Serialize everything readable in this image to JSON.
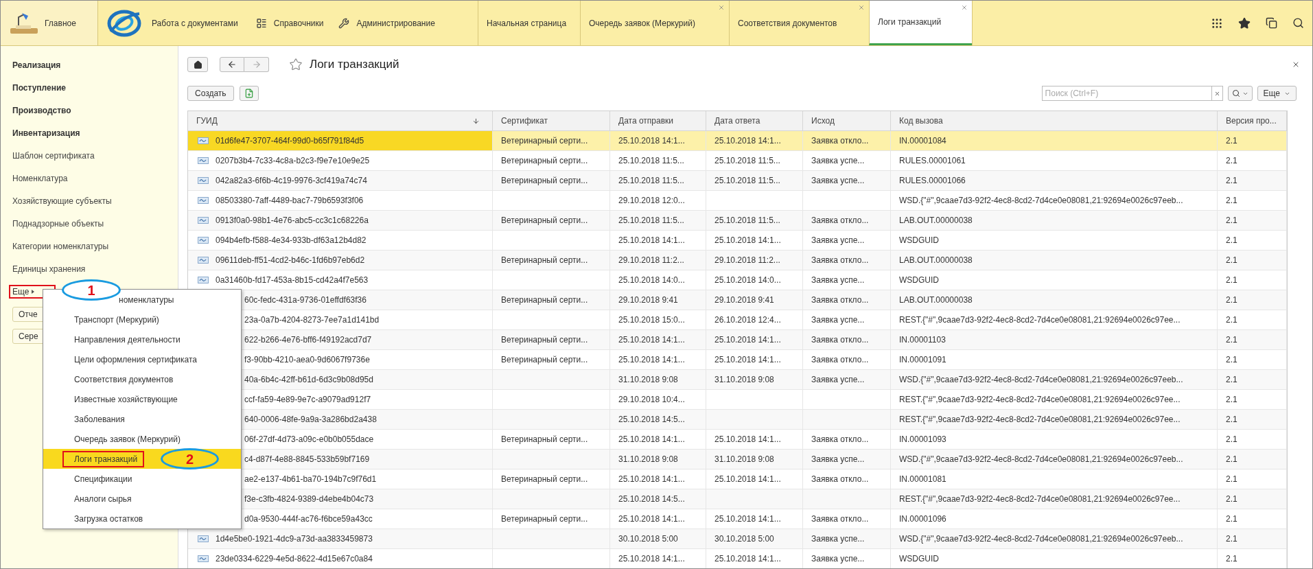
{
  "top_nav": {
    "sections": [
      {
        "label": "Главное",
        "kind": "home"
      },
      {
        "label": "Работа с документами",
        "kind": "logo"
      },
      {
        "label": "Справочники",
        "kind": "list"
      },
      {
        "label": "Администрирование",
        "kind": "wrench"
      }
    ]
  },
  "tabs": [
    {
      "label": "Начальная страница",
      "selected": false,
      "closable": false
    },
    {
      "label": "Очередь заявок (Меркурий)",
      "selected": false,
      "closable": true
    },
    {
      "label": "Соответствия документов",
      "selected": false,
      "closable": true
    },
    {
      "label": "Логи транзакций",
      "selected": true,
      "closable": true
    }
  ],
  "sidebar": {
    "items": [
      {
        "label": "Реализация",
        "bold": true
      },
      {
        "label": "Поступление",
        "bold": true
      },
      {
        "label": "Производство",
        "bold": true
      },
      {
        "label": "Инвентаризация",
        "bold": true
      },
      {
        "label": "Шаблон сертификата",
        "bold": false
      },
      {
        "label": "Номенклатура",
        "bold": false
      },
      {
        "label": "Хозяйствующие субъекты",
        "bold": false
      },
      {
        "label": "Поднадзорные объекты",
        "bold": false
      },
      {
        "label": "Категории номенклатуры",
        "bold": false
      },
      {
        "label": "Единицы хранения",
        "bold": false
      }
    ],
    "more": {
      "label": "Еще",
      "callout": "1"
    },
    "buttons": [
      "Отче",
      "Сере"
    ]
  },
  "menu": {
    "items": [
      {
        "label": "номенклатуры",
        "selected": false,
        "obscured": true
      },
      {
        "label": "Транспорт (Меркурий)",
        "selected": false
      },
      {
        "label": "Направления деятельности",
        "selected": false
      },
      {
        "label": "Цели оформления сертификата",
        "selected": false
      },
      {
        "label": "Соответствия документов",
        "selected": false
      },
      {
        "label": "Известные хозяйствующие",
        "selected": false
      },
      {
        "label": "Заболевания",
        "selected": false
      },
      {
        "label": "Очередь заявок (Меркурий)",
        "selected": false
      },
      {
        "label": "Логи транзакций",
        "selected": true,
        "callout": "2"
      },
      {
        "label": "Спецификации",
        "selected": false
      },
      {
        "label": "Аналоги сырья",
        "selected": false
      },
      {
        "label": "Загрузка остатков",
        "selected": false
      }
    ]
  },
  "page": {
    "title": "Логи транзакций",
    "create_button": "Создать",
    "search": {
      "placeholder": "Поиск (Ctrl+F)"
    },
    "more_button": "Еще"
  },
  "table": {
    "columns": [
      {
        "label": "ГУИД",
        "sorted": true
      },
      {
        "label": "Сертификат",
        "sorted": false
      },
      {
        "label": "Дата отправки",
        "sorted": false
      },
      {
        "label": "Дата ответа",
        "sorted": false
      },
      {
        "label": "Исход",
        "sorted": false
      },
      {
        "label": "Код вызова",
        "sorted": false
      },
      {
        "label": "Версия про...",
        "sorted": false
      }
    ],
    "rows": [
      {
        "selected": true,
        "obscured": false,
        "guid": "01d6fe47-3707-464f-99d0-b65f791f84d5",
        "certificate": "Ветеринарный серти...",
        "sent": "25.10.2018 14:1...",
        "answered": "25.10.2018 14:1...",
        "outcome": "Заявка откло...",
        "code": "IN.00001084",
        "version": "2.1"
      },
      {
        "selected": false,
        "obscured": false,
        "guid": "0207b3b4-7c33-4c8a-b2c3-f9e7e10e9e25",
        "certificate": "Ветеринарный серти...",
        "sent": "25.10.2018 11:5...",
        "answered": "25.10.2018 11:5...",
        "outcome": "Заявка успе...",
        "code": "RULES.00001061",
        "version": "2.1"
      },
      {
        "selected": false,
        "obscured": false,
        "guid": "042a82a3-6f6b-4c19-9976-3cf419a74c74",
        "certificate": "Ветеринарный серти...",
        "sent": "25.10.2018 11:5...",
        "answered": "25.10.2018 11:5...",
        "outcome": "Заявка успе...",
        "code": "RULES.00001066",
        "version": "2.1"
      },
      {
        "selected": false,
        "obscured": false,
        "guid": "08503380-7aff-4489-bac7-79b6593f3f06",
        "sent": "29.10.2018 12:0...",
        "code": "WSD.{\"#\",9caae7d3-92f2-4ec8-8cd2-7d4ce0e08081,21:92694e0026c97eeb...",
        "version": "2.1"
      },
      {
        "selected": false,
        "obscured": false,
        "guid": "0913f0a0-98b1-4e76-abc5-cc3c1c68226a",
        "certificate": "Ветеринарный серти...",
        "sent": "25.10.2018 11:5...",
        "answered": "25.10.2018 11:5...",
        "outcome": "Заявка откло...",
        "code": "LAB.OUT.00000038",
        "version": "2.1"
      },
      {
        "selected": false,
        "obscured": false,
        "guid": "094b4efb-f588-4e34-933b-df63a12b4d82",
        "sent": "25.10.2018 14:1...",
        "answered": "25.10.2018 14:1...",
        "outcome": "Заявка успе...",
        "code": "WSDGUID",
        "version": "2.1"
      },
      {
        "selected": false,
        "obscured": false,
        "guid": "09611deb-ff51-4cd2-b46c-1fd6b97eb6d2",
        "certificate": "Ветеринарный серти...",
        "sent": "29.10.2018 11:2...",
        "answered": "29.10.2018 11:2...",
        "outcome": "Заявка откло...",
        "code": "LAB.OUT.00000038",
        "version": "2.1"
      },
      {
        "selected": false,
        "obscured": false,
        "guid": "0a31460b-fd17-453a-8b15-cd42a4f7e563",
        "sent": "25.10.2018 14:0...",
        "answered": "25.10.2018 14:0...",
        "outcome": "Заявка успе...",
        "code": "WSDGUID",
        "version": "2.1"
      },
      {
        "selected": false,
        "obscured": true,
        "guid": "60c-fedc-431a-9736-01effdf63f36",
        "certificate": "Ветеринарный серти...",
        "sent": "29.10.2018 9:41",
        "answered": "29.10.2018 9:41",
        "outcome": "Заявка откло...",
        "code": "LAB.OUT.00000038",
        "version": "2.1"
      },
      {
        "selected": false,
        "obscured": true,
        "guid": "23a-0a7b-4204-8273-7ee7a1d141bd",
        "sent": "25.10.2018 15:0...",
        "answered": "26.10.2018 12:4...",
        "outcome": "Заявка успе...",
        "code": "REST.{\"#\",9caae7d3-92f2-4ec8-8cd2-7d4ce0e08081,21:92694e0026c97ee...",
        "version": "2.1"
      },
      {
        "selected": false,
        "obscured": true,
        "guid": "622-b266-4e76-bff6-f49192acd7d7",
        "certificate": "Ветеринарный серти...",
        "sent": "25.10.2018 14:1...",
        "answered": "25.10.2018 14:1...",
        "outcome": "Заявка откло...",
        "code": "IN.00001103",
        "version": "2.1"
      },
      {
        "selected": false,
        "obscured": true,
        "guid": "f3-90bb-4210-aea0-9d6067f9736e",
        "certificate": "Ветеринарный серти...",
        "sent": "25.10.2018 14:1...",
        "answered": "25.10.2018 14:1...",
        "outcome": "Заявка откло...",
        "code": "IN.00001091",
        "version": "2.1"
      },
      {
        "selected": false,
        "obscured": true,
        "guid": "40a-6b4c-42ff-b61d-6d3c9b08d95d",
        "sent": "31.10.2018 9:08",
        "answered": "31.10.2018 9:08",
        "outcome": "Заявка успе...",
        "code": "WSD.{\"#\",9caae7d3-92f2-4ec8-8cd2-7d4ce0e08081,21:92694e0026c97eeb...",
        "version": "2.1"
      },
      {
        "selected": false,
        "obscured": true,
        "guid": "ccf-fa59-4e89-9e7c-a9079ad912f7",
        "sent": "29.10.2018 10:4...",
        "code": "REST.{\"#\",9caae7d3-92f2-4ec8-8cd2-7d4ce0e08081,21:92694e0026c97ee...",
        "version": "2.1"
      },
      {
        "selected": false,
        "obscured": true,
        "guid": "640-0006-48fe-9a9a-3a286bd2a438",
        "sent": "25.10.2018 14:5...",
        "code": "REST.{\"#\",9caae7d3-92f2-4ec8-8cd2-7d4ce0e08081,21:92694e0026c97ee...",
        "version": "2.1"
      },
      {
        "selected": false,
        "obscured": true,
        "guid": "06f-27df-4d73-a09c-e0b0b055dace",
        "certificate": "Ветеринарный серти...",
        "sent": "25.10.2018 14:1...",
        "answered": "25.10.2018 14:1...",
        "outcome": "Заявка откло...",
        "code": "IN.00001093",
        "version": "2.1"
      },
      {
        "selected": false,
        "obscured": true,
        "guid": "c4-d87f-4e88-8845-533b59bf7169",
        "sent": "31.10.2018 9:08",
        "answered": "31.10.2018 9:08",
        "outcome": "Заявка успе...",
        "code": "WSD.{\"#\",9caae7d3-92f2-4ec8-8cd2-7d4ce0e08081,21:92694e0026c97eeb...",
        "version": "2.1"
      },
      {
        "selected": false,
        "obscured": true,
        "guid": "ae2-e137-4b61-ba70-194b7c9f76d1",
        "certificate": "Ветеринарный серти...",
        "sent": "25.10.2018 14:1...",
        "answered": "25.10.2018 14:1...",
        "outcome": "Заявка откло...",
        "code": "IN.00001081",
        "version": "2.1"
      },
      {
        "selected": false,
        "obscured": true,
        "guid": "f3e-c3fb-4824-9389-d4ebe4b04c73",
        "sent": "25.10.2018 14:5...",
        "code": "REST.{\"#\",9caae7d3-92f2-4ec8-8cd2-7d4ce0e08081,21:92694e0026c97ee...",
        "version": "2.1"
      },
      {
        "selected": false,
        "obscured": true,
        "guid": "d0a-9530-444f-ac76-f6bce59a43cc",
        "certificate": "Ветеринарный серти...",
        "sent": "25.10.2018 14:1...",
        "answered": "25.10.2018 14:1...",
        "outcome": "Заявка откло...",
        "code": "IN.00001096",
        "version": "2.1"
      },
      {
        "selected": false,
        "obscured": false,
        "guid": "1d4e5be0-1921-4dc9-a73d-aa3833459873",
        "sent": "30.10.2018 5:00",
        "answered": "30.10.2018 5:00",
        "outcome": "Заявка успе...",
        "code": "WSD.{\"#\",9caae7d3-92f2-4ec8-8cd2-7d4ce0e08081,21:92694e0026c97eeb...",
        "version": "2.1"
      },
      {
        "selected": false,
        "obscured": false,
        "guid": "23de0334-6229-4e5d-8622-4d15e67c0a84",
        "sent": "25.10.2018 14:1...",
        "answered": "25.10.2018 14:1...",
        "outcome": "Заявка успе...",
        "code": "WSDGUID",
        "version": "2.1"
      }
    ]
  }
}
